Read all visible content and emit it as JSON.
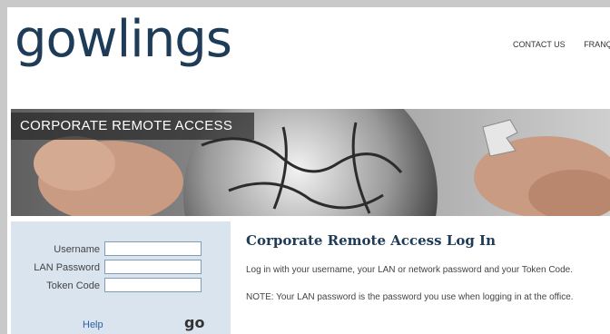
{
  "brand": {
    "logo": "gowlings"
  },
  "topnav": {
    "contact": "CONTACT US",
    "francais": "FRANÇ"
  },
  "banner": {
    "title": "CORPORATE REMOTE ACCESS"
  },
  "login": {
    "username_label": "Username",
    "username_value": "",
    "lan_password_label": "LAN Password",
    "lan_password_value": "",
    "token_label": "Token Code",
    "token_value": "",
    "help": "Help",
    "go": "go"
  },
  "content": {
    "title": "Corporate Remote Access Log In",
    "p1": "Log in with your username, your LAN or network password and your Token Code.",
    "p2": "NOTE: Your LAN password is the password you use when logging in at the office."
  },
  "colors": {
    "brand": "#1e3b57",
    "link": "#2a5fa0",
    "sidebar_bg": "#d9e4ee"
  }
}
